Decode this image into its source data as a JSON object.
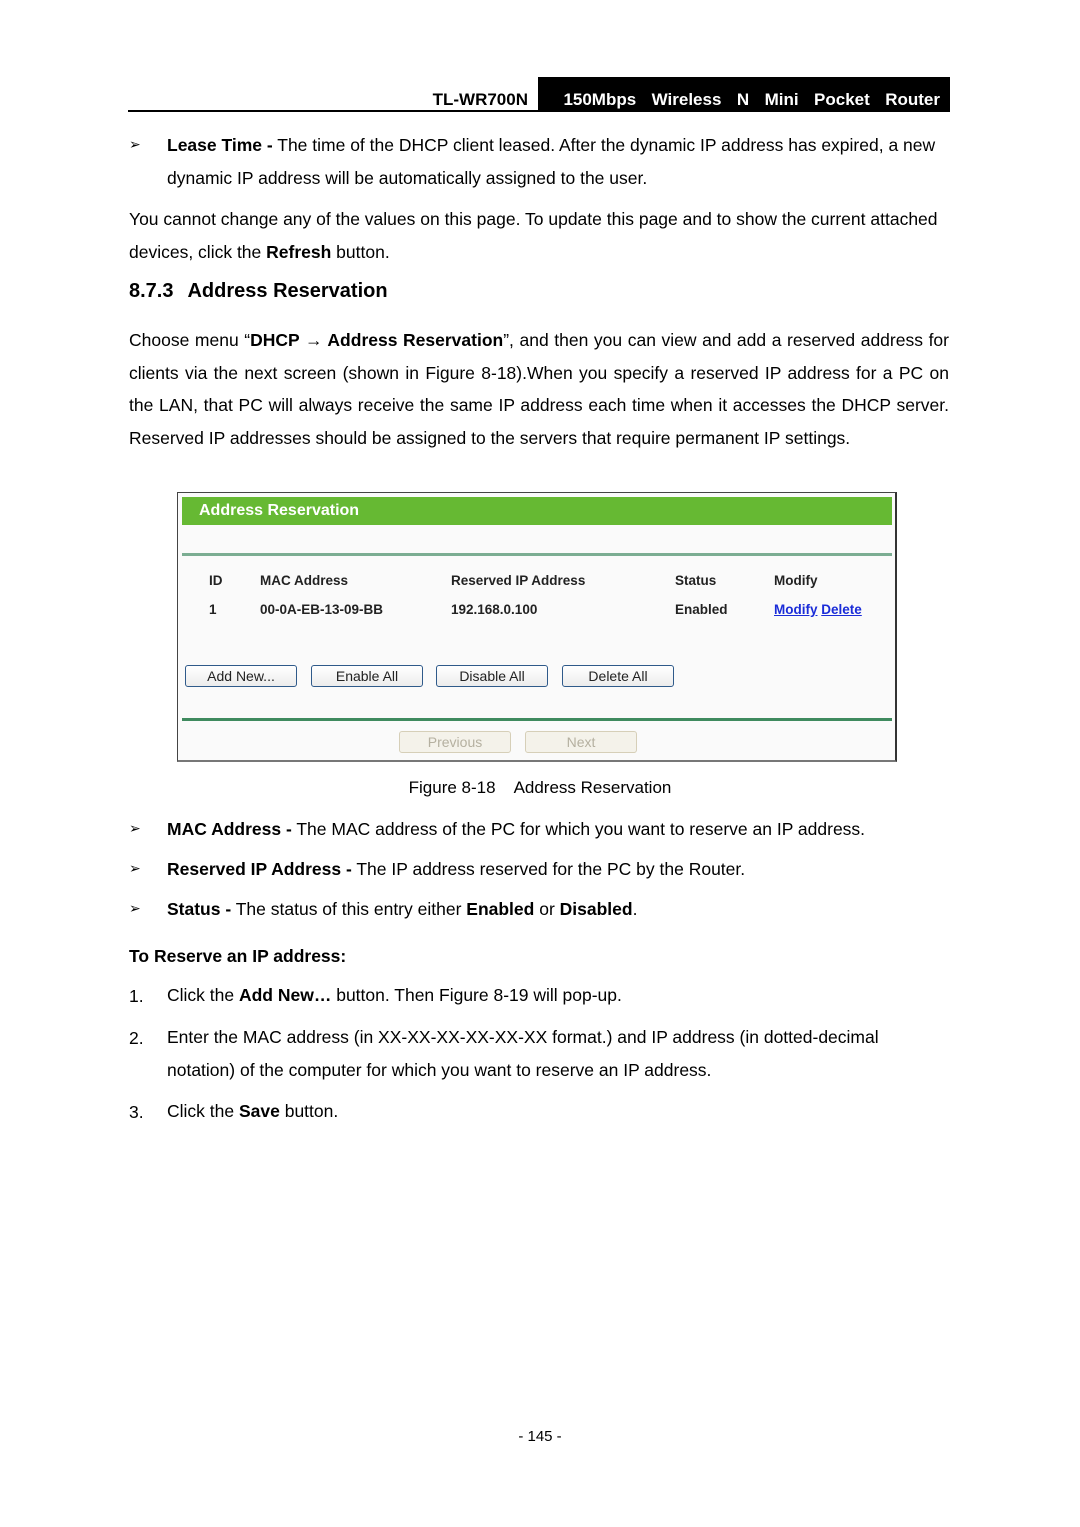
{
  "header": {
    "model": "TL-WR700N",
    "product": "150Mbps  Wireless  N  Mini  Pocket  Router"
  },
  "lease_time": {
    "bullet": "➢",
    "term": "Lease Time -",
    "text": " The time of the DHCP client leased. After the dynamic IP address has expired, a new dynamic IP address will be automatically assigned to the user."
  },
  "intro": {
    "text_before": "You cannot change any of the values on this page. To update this page and to show the current attached devices, click the ",
    "bold": "Refresh",
    "text_after": " button."
  },
  "section": {
    "number": "8.7.3",
    "title": "Address Reservation"
  },
  "section_intro": {
    "t1": "Choose menu “",
    "b1": "DHCP",
    "arrow": " → ",
    "b2": "Address Reservation",
    "t2": "”, and then you can view and add a reserved address for clients via the next screen (shown in Figure 8-18).When you specify a reserved IP address for a PC on the LAN, that PC will always receive the same IP address each time when it accesses the DHCP server. Reserved IP addresses should be assigned to the servers that require permanent IP settings."
  },
  "figure": {
    "panel_title": "Address Reservation",
    "accent_color": "#66b933",
    "columns": [
      "ID",
      "MAC Address",
      "Reserved IP Address",
      "Status",
      "Modify"
    ],
    "rows": [
      {
        "id": "1",
        "mac": "00-0A-EB-13-09-BB",
        "ip": "192.168.0.100",
        "status": "Enabled",
        "actions": [
          "Modify",
          "Delete"
        ]
      }
    ],
    "buttons": [
      "Add New...",
      "Enable All",
      "Disable All",
      "Delete All"
    ],
    "pager": {
      "previous": "Previous",
      "next": "Next"
    },
    "caption_label": "Figure 8-18",
    "caption_title": "Address Reservation"
  },
  "definitions": [
    {
      "bullet": "➢",
      "term": "MAC Address -",
      "text": " The MAC address of the PC for which you want to reserve an IP address."
    },
    {
      "bullet": "➢",
      "term": "Reserved IP Address -",
      "text": " The IP address reserved for the PC by the Router."
    },
    {
      "bullet": "➢",
      "term": "Status -",
      "text": " The status of this entry either ",
      "b2": "Enabled",
      "t3": " or ",
      "b3": "Disabled",
      "t4": "."
    }
  ],
  "procedure": {
    "title": "To Reserve an IP address:",
    "steps": [
      {
        "num": "1.",
        "t1": "Click the ",
        "b1": "Add New…",
        "t2": " button. Then Figure 8-19 will pop-up."
      },
      {
        "num": "2.",
        "t1": "Enter the MAC address (in XX-XX-XX-XX-XX-XX format.) and IP address (in dotted-decimal notation) of the computer for which you want to reserve an IP address."
      },
      {
        "num": "3.",
        "t1": "Click the ",
        "b1": "Save",
        "t2": " button."
      }
    ]
  },
  "page_number": "- 145 -"
}
